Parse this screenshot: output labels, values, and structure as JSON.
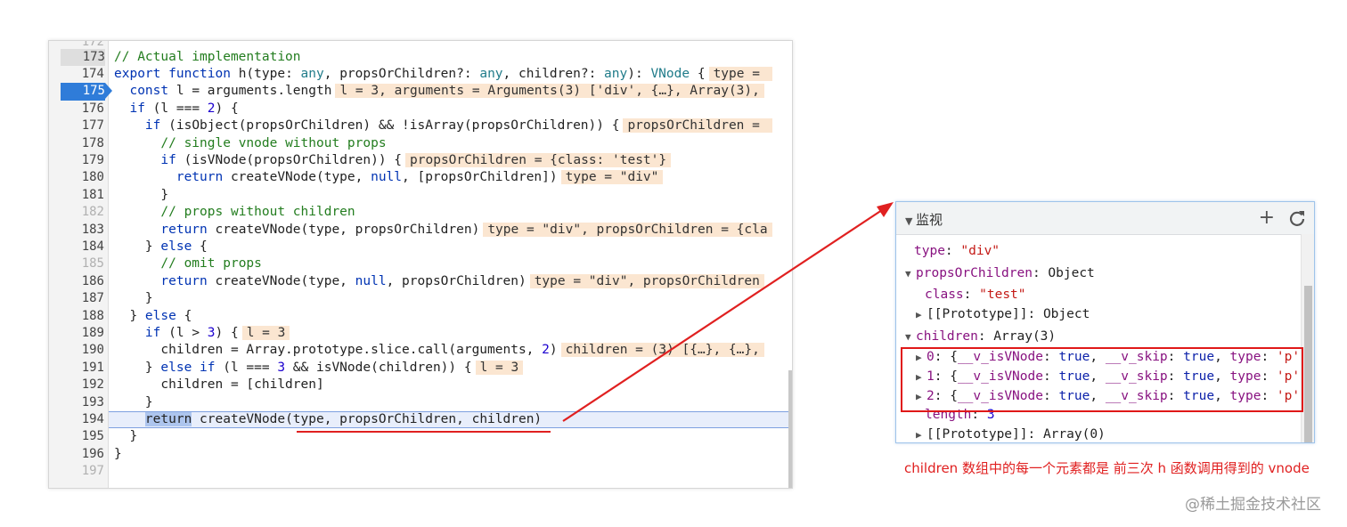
{
  "editor": {
    "top_partial_number": "172",
    "lines": [
      {
        "n": "173",
        "segs": [
          [
            "cm",
            "// Actual implementation"
          ]
        ]
      },
      {
        "n": "174",
        "segs": [
          [
            "kb",
            "export "
          ],
          [
            "kb",
            "function "
          ],
          [
            "",
            "h(type: "
          ],
          [
            "ty",
            "any"
          ],
          [
            "",
            ", propsOrChildren?: "
          ],
          [
            "ty",
            "any"
          ],
          [
            "",
            ", children?: "
          ],
          [
            "ty",
            "any"
          ],
          [
            "",
            "): "
          ],
          [
            "ty",
            "VNode"
          ],
          [
            "",
            " {"
          ],
          [
            "ann",
            "type = "
          ]
        ]
      },
      {
        "n": "175",
        "bp": true,
        "segs": [
          [
            "",
            "  "
          ],
          [
            "kb",
            "const "
          ],
          [
            "",
            "l = arguments.length"
          ],
          [
            "ann",
            "l = 3, arguments = Arguments(3) ['div', {…}, Array(3),"
          ]
        ]
      },
      {
        "n": "176",
        "segs": [
          [
            "",
            "  "
          ],
          [
            "kb",
            "if "
          ],
          [
            "",
            "(l === "
          ],
          [
            "num",
            "2"
          ],
          [
            "",
            ") {"
          ]
        ]
      },
      {
        "n": "177",
        "segs": [
          [
            "",
            "    "
          ],
          [
            "kb",
            "if "
          ],
          [
            "",
            "(isObject(propsOrChildren) && !isArray(propsOrChildren)) {"
          ],
          [
            "ann",
            "propsOrChildren = "
          ]
        ]
      },
      {
        "n": "178",
        "segs": [
          [
            "",
            "      "
          ],
          [
            "cm",
            "// single vnode without props"
          ]
        ]
      },
      {
        "n": "179",
        "segs": [
          [
            "",
            "      "
          ],
          [
            "kb",
            "if "
          ],
          [
            "",
            "(isVNode(propsOrChildren)) {"
          ],
          [
            "ann",
            "propsOrChildren = {class: 'test'}"
          ]
        ]
      },
      {
        "n": "180",
        "segs": [
          [
            "",
            "        "
          ],
          [
            "kb",
            "return "
          ],
          [
            "",
            "createVNode(type, "
          ],
          [
            "kb",
            "null"
          ],
          [
            "",
            ", [propsOrChildren])"
          ],
          [
            "ann",
            "type = \"div\""
          ]
        ]
      },
      {
        "n": "181",
        "segs": [
          [
            "",
            "      }"
          ]
        ]
      },
      {
        "n": "182",
        "dim": true,
        "segs": [
          [
            "",
            "      "
          ],
          [
            "cm",
            "// props without children"
          ]
        ]
      },
      {
        "n": "183",
        "segs": [
          [
            "",
            "      "
          ],
          [
            "kb",
            "return "
          ],
          [
            "",
            "createVNode(type, propsOrChildren)"
          ],
          [
            "ann",
            "type = \"div\", propsOrChildren = {cla"
          ]
        ]
      },
      {
        "n": "184",
        "segs": [
          [
            "",
            "    } "
          ],
          [
            "kb",
            "else "
          ],
          [
            "",
            "{"
          ]
        ]
      },
      {
        "n": "185",
        "dim": true,
        "segs": [
          [
            "",
            "      "
          ],
          [
            "cm",
            "// omit props"
          ]
        ]
      },
      {
        "n": "186",
        "segs": [
          [
            "",
            "      "
          ],
          [
            "kb",
            "return "
          ],
          [
            "",
            "createVNode(type, "
          ],
          [
            "kb",
            "null"
          ],
          [
            "",
            ", propsOrChildren)"
          ],
          [
            "ann",
            "type = \"div\", propsOrChildren"
          ]
        ]
      },
      {
        "n": "187",
        "segs": [
          [
            "",
            "    }"
          ]
        ]
      },
      {
        "n": "188",
        "segs": [
          [
            "",
            "  } "
          ],
          [
            "kb",
            "else "
          ],
          [
            "",
            "{"
          ]
        ]
      },
      {
        "n": "189",
        "segs": [
          [
            "",
            "    "
          ],
          [
            "kb",
            "if "
          ],
          [
            "",
            "(l > "
          ],
          [
            "num",
            "3"
          ],
          [
            "",
            ") {"
          ],
          [
            "ann",
            "l = 3"
          ]
        ]
      },
      {
        "n": "190",
        "segs": [
          [
            "",
            "      children = Array.prototype.slice.call(arguments, "
          ],
          [
            "num",
            "2"
          ],
          [
            "",
            ")"
          ],
          [
            "ann",
            "children = (3) [{…}, {…},"
          ]
        ]
      },
      {
        "n": "191",
        "segs": [
          [
            "",
            "    } "
          ],
          [
            "kb",
            "else if "
          ],
          [
            "",
            "(l === "
          ],
          [
            "num",
            "3"
          ],
          [
            "",
            " && isVNode(children)) {"
          ],
          [
            "ann",
            "l = 3"
          ]
        ]
      },
      {
        "n": "192",
        "segs": [
          [
            "",
            "      children = [children]"
          ]
        ]
      },
      {
        "n": "193",
        "segs": [
          [
            "",
            "    }"
          ]
        ]
      },
      {
        "n": "194",
        "current": true,
        "segs": [
          [
            "",
            "    "
          ],
          [
            "retsel",
            "return"
          ],
          [
            "",
            " createVNode(type, propsOrChildren, children)"
          ]
        ]
      },
      {
        "n": "195",
        "segs": [
          [
            "",
            "  }"
          ]
        ]
      },
      {
        "n": "196",
        "segs": [
          [
            "",
            "}"
          ]
        ]
      },
      {
        "n": "197",
        "dim": true,
        "segs": []
      }
    ]
  },
  "watch": {
    "title": "监视",
    "add_label": "+",
    "rows": [
      {
        "tri": "",
        "parts": [
          [
            "prop",
            "type"
          ],
          [
            "",
            ": "
          ],
          [
            "str",
            "\"div\""
          ]
        ]
      },
      {
        "tri": "▼",
        "parts": [
          [
            "prop",
            "propsOrChildren"
          ],
          [
            "",
            ": Object"
          ]
        ]
      },
      {
        "tri": "",
        "parts": [
          [
            "prop",
            "class"
          ],
          [
            "",
            ": "
          ],
          [
            "str",
            "\"test\""
          ]
        ]
      },
      {
        "tri": "▶",
        "parts": [
          [
            "",
            "[[Prototype]]: Object"
          ]
        ]
      },
      {
        "tri": "▼",
        "parts": [
          [
            "prop",
            "children"
          ],
          [
            "",
            ": Array(3)"
          ]
        ]
      },
      {
        "tri": "▶",
        "parts": [
          [
            "prop",
            "0"
          ],
          [
            "",
            ": {"
          ],
          [
            "prop",
            "__v_isVNode"
          ],
          [
            "",
            ": "
          ],
          [
            "bool",
            "true"
          ],
          [
            "",
            ", "
          ],
          [
            "prop",
            "__v_skip"
          ],
          [
            "",
            ": "
          ],
          [
            "bool",
            "true"
          ],
          [
            "",
            ", "
          ],
          [
            "prop",
            "type"
          ],
          [
            "",
            ": "
          ],
          [
            "str",
            "'p'"
          ]
        ]
      },
      {
        "tri": "▶",
        "parts": [
          [
            "prop",
            "1"
          ],
          [
            "",
            ": {"
          ],
          [
            "prop",
            "__v_isVNode"
          ],
          [
            "",
            ": "
          ],
          [
            "bool",
            "true"
          ],
          [
            "",
            ", "
          ],
          [
            "prop",
            "__v_skip"
          ],
          [
            "",
            ": "
          ],
          [
            "bool",
            "true"
          ],
          [
            "",
            ", "
          ],
          [
            "prop",
            "type"
          ],
          [
            "",
            ": "
          ],
          [
            "str",
            "'p'"
          ]
        ]
      },
      {
        "tri": "▶",
        "parts": [
          [
            "prop",
            "2"
          ],
          [
            "",
            ": {"
          ],
          [
            "prop",
            "__v_isVNode"
          ],
          [
            "",
            ": "
          ],
          [
            "bool",
            "true"
          ],
          [
            "",
            ", "
          ],
          [
            "prop",
            "__v_skip"
          ],
          [
            "",
            ": "
          ],
          [
            "bool",
            "true"
          ],
          [
            "",
            ", "
          ],
          [
            "prop",
            "type"
          ],
          [
            "",
            ": "
          ],
          [
            "str",
            "'p'"
          ]
        ]
      },
      {
        "tri": "",
        "parts": [
          [
            "prop",
            "length"
          ],
          [
            "",
            ": "
          ],
          [
            "num",
            "3"
          ]
        ]
      },
      {
        "tri": "▶",
        "parts": [
          [
            "",
            "[[Prototype]]: Array(0)"
          ]
        ]
      }
    ]
  },
  "caption": "children 数组中的每一个元素都是 前三次 h 函数调用得到的 vnode",
  "watermark": "@稀土掘金技术社区",
  "colors": {
    "annotation": "#e02020",
    "breakpoint": "#2f7cd9"
  }
}
